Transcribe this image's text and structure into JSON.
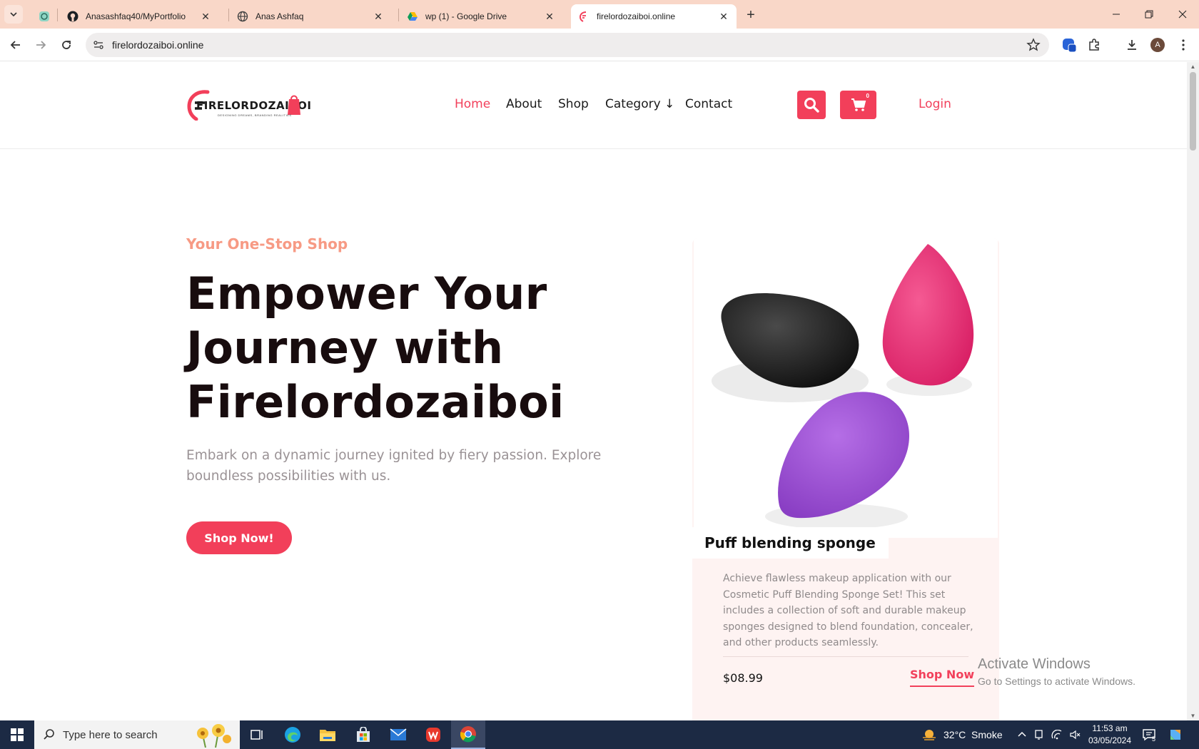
{
  "browser": {
    "tabs": [
      {
        "title": "",
        "favicon": "chatgpt-icon"
      },
      {
        "title": "Anasashfaq40/MyPortfolio",
        "favicon": "github-icon"
      },
      {
        "title": "Anas Ashfaq",
        "favicon": "globe-icon"
      },
      {
        "title": "wp (1) - Google Drive",
        "favicon": "google-drive-icon"
      },
      {
        "title": "firelordozaiboi.online",
        "favicon": "site-favicon",
        "active": true
      }
    ],
    "url": "firelordozaiboi.online",
    "profile_initial": "A"
  },
  "site": {
    "logo_text": "FIRELORDOZAIBOI",
    "logo_tagline": "DESIGNING DREAMS, BRANDING REALITIES",
    "nav": [
      "Home",
      "About",
      "Shop",
      "Category ↓",
      "Contact"
    ],
    "active_nav": "Home",
    "cart_count": "0",
    "login_label": "Login",
    "accent_color": "#f23f5a"
  },
  "hero": {
    "eyebrow": "Your One-Stop Shop",
    "title_lines": [
      "Empower Your",
      "Journey with",
      "Firelordozaiboi"
    ],
    "description": "Embark on a dynamic journey ignited by fiery passion. Explore boundless possibilities with us.",
    "cta_label": "Shop Now!"
  },
  "product_card": {
    "title": "Puff blending sponge",
    "description": "Achieve flawless makeup application with our Cosmetic Puff Blending Sponge Set! This set includes a collection of soft and durable makeup sponges designed to blend foundation, concealer, and other products seamlessly.",
    "price": "$08.99",
    "cta_label": "Shop Now"
  },
  "watermark": {
    "line1": "Activate Windows",
    "line2": "Go to Settings to activate Windows."
  },
  "taskbar": {
    "search_placeholder": "Type here to search",
    "weather": "32°C  Smoke",
    "time": "11:53 am",
    "date": "03/05/2024",
    "notification_count": "5"
  }
}
